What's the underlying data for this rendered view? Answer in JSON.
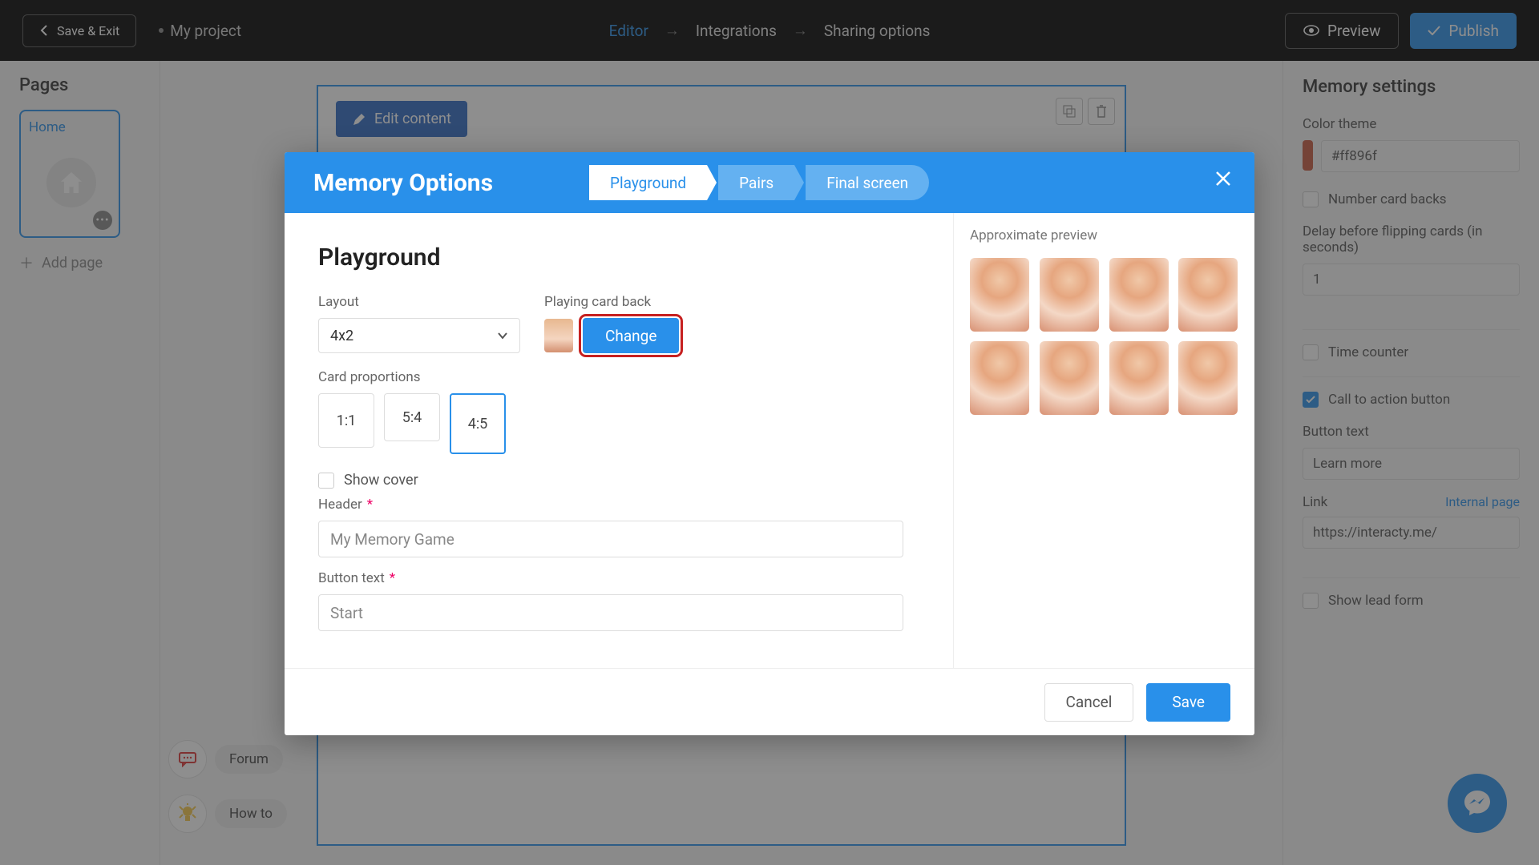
{
  "topbar": {
    "save_exit": "Save & Exit",
    "project_name": "My project",
    "steps": {
      "editor": "Editor",
      "integrations": "Integrations",
      "sharing": "Sharing options"
    },
    "preview": "Preview",
    "publish": "Publish"
  },
  "left_sidebar": {
    "title": "Pages",
    "home": "Home",
    "add_page": "Add page"
  },
  "canvas": {
    "edit_content": "Edit content"
  },
  "float": {
    "forum": "Forum",
    "howto": "How to"
  },
  "right_panel": {
    "title": "Memory settings",
    "color_theme_label": "Color theme",
    "color_value": "#ff896f",
    "number_backs": "Number card backs",
    "delay_label": "Delay before flipping cards (in seconds)",
    "delay_value": "1",
    "time_counter": "Time counter",
    "cta": "Call to action button",
    "button_text_label": "Button text",
    "button_text_value": "Learn more",
    "link_label": "Link",
    "internal_page": "Internal page",
    "link_value": "https://interacty.me/",
    "lead_form": "Show lead form"
  },
  "modal": {
    "title": "Memory Options",
    "tabs": {
      "playground": "Playground",
      "pairs": "Pairs",
      "final": "Final screen"
    },
    "section_title": "Playground",
    "layout_label": "Layout",
    "layout_value": "4x2",
    "card_back_label": "Playing card back",
    "change": "Change",
    "proportions_label": "Card proportions",
    "proportions": {
      "p1": "1:1",
      "p2": "5:4",
      "p3": "4:5"
    },
    "show_cover": "Show cover",
    "header_label": "Header",
    "header_value": "My Memory Game",
    "button_text_label": "Button text",
    "button_text_value": "Start",
    "preview_label": "Approximate preview",
    "cancel": "Cancel",
    "save": "Save"
  }
}
